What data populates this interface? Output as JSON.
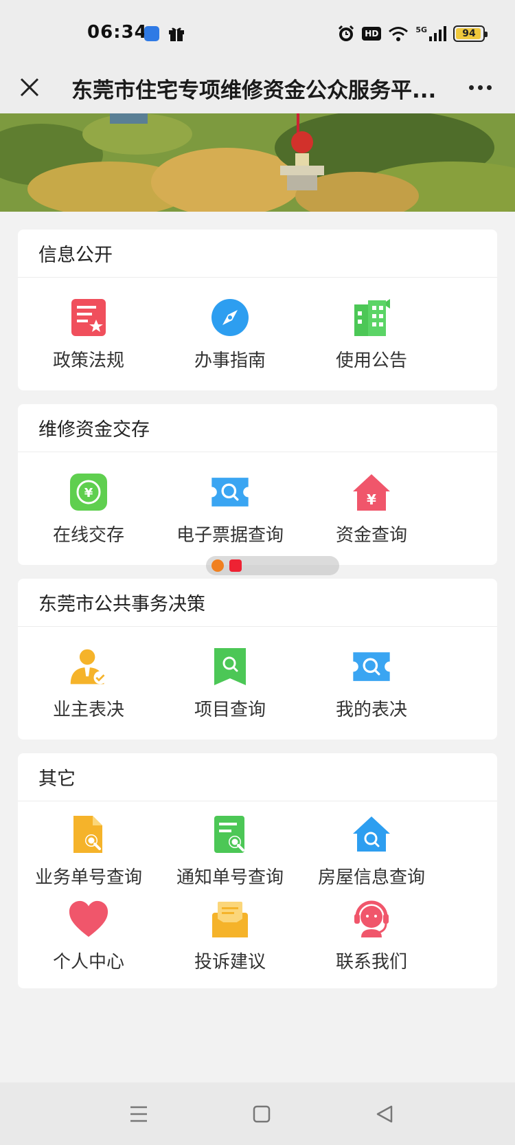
{
  "status_bar": {
    "time": "06:34",
    "battery_level": "94",
    "network_label": "5G",
    "hd_label": "HD",
    "icons": [
      "app-icon",
      "gift-icon",
      "alarm-icon",
      "hd-icon",
      "wifi-icon",
      "signal-icon",
      "battery-icon"
    ]
  },
  "header": {
    "title": "东莞市住宅专项维修资金公众服务平...",
    "close_icon": "close-icon",
    "more_icon": "more-icon"
  },
  "colors": {
    "red": "#f04f5c",
    "blue": "#2d9ef0",
    "green": "#4cc756",
    "orange": "#f5b32a",
    "pink": "#f0566b"
  },
  "sections": [
    {
      "title": "信息公开",
      "items": [
        {
          "label": "政策法规",
          "icon": "policy-doc-icon"
        },
        {
          "label": "办事指南",
          "icon": "compass-icon"
        },
        {
          "label": "使用公告",
          "icon": "building-icon"
        }
      ]
    },
    {
      "title": "维修资金交存",
      "items": [
        {
          "label": "在线交存",
          "icon": "yuan-cycle-icon"
        },
        {
          "label": "电子票据查询",
          "icon": "ticket-search-icon"
        },
        {
          "label": "资金查询",
          "icon": "house-yuan-icon"
        }
      ]
    },
    {
      "title": "东莞市公共事务决策",
      "items": [
        {
          "label": "业主表决",
          "icon": "owner-vote-icon"
        },
        {
          "label": "项目查询",
          "icon": "project-search-icon"
        },
        {
          "label": "我的表决",
          "icon": "ticket-search-icon"
        }
      ]
    },
    {
      "title": "其它",
      "items": [
        {
          "label": "业务单号查询",
          "icon": "doc-search-icon"
        },
        {
          "label": "通知单号查询",
          "icon": "notice-search-icon"
        },
        {
          "label": "房屋信息查询",
          "icon": "house-search-icon"
        },
        {
          "label": "个人中心",
          "icon": "heart-icon"
        },
        {
          "label": "投诉建议",
          "icon": "mail-icon"
        },
        {
          "label": "联系我们",
          "icon": "support-agent-icon"
        }
      ]
    }
  ],
  "nav_bar": {
    "icons": [
      "menu-icon",
      "home-square-icon",
      "back-triangle-icon"
    ]
  }
}
